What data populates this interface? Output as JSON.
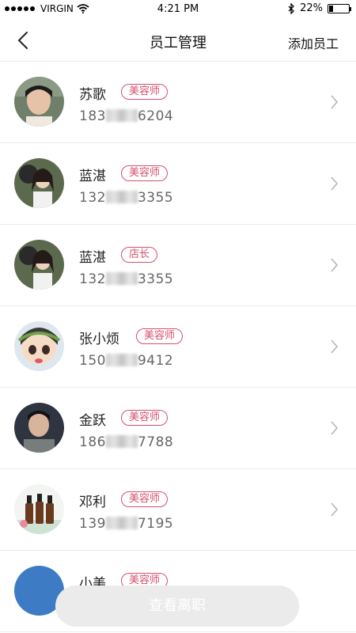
{
  "status": {
    "carrier": "VIRGIN",
    "time": "4:21 PM",
    "battery": "22%",
    "battery_level": 0.22
  },
  "nav": {
    "title": "员工管理",
    "action": "添加员工"
  },
  "employees": [
    {
      "name": "苏歌",
      "role": "美容师",
      "phone_prefix": "183",
      "phone_suffix": "6204"
    },
    {
      "name": "蓝湛",
      "role": "美容师",
      "phone_prefix": "132",
      "phone_suffix": "3355"
    },
    {
      "name": "蓝湛",
      "role": "店长",
      "phone_prefix": "132",
      "phone_suffix": "3355"
    },
    {
      "name": "张小烦",
      "role": "美容师",
      "phone_prefix": "150",
      "phone_suffix": "9412"
    },
    {
      "name": "金跃",
      "role": "美容师",
      "phone_prefix": "186",
      "phone_suffix": "7788"
    },
    {
      "name": "邓利",
      "role": "美容师",
      "phone_prefix": "139",
      "phone_suffix": "7195"
    },
    {
      "name": "小美",
      "role": "美容师",
      "phone_prefix": "",
      "phone_suffix": ""
    }
  ],
  "footer": {
    "button_label": "查看离职"
  },
  "colors": {
    "accent": "#d5506d",
    "divider": "#ececec",
    "button_bg": "#ebebeb"
  }
}
